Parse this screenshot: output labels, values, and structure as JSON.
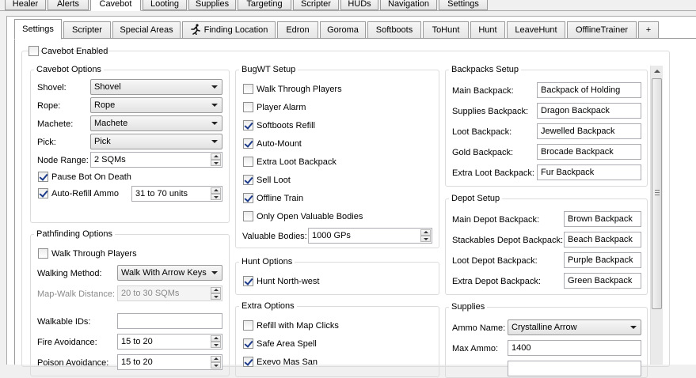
{
  "top_tabs": [
    "Healer",
    "Alerts",
    "Cavebot",
    "Looting",
    "Supplies",
    "Targeting",
    "Scripter",
    "HUDs",
    "Navigation",
    "Settings"
  ],
  "sub_tabs": [
    "Settings",
    "Scripter",
    "Special Areas",
    "Finding Location",
    "Edron",
    "Goroma",
    "Softboots",
    "ToHunt",
    "Hunt",
    "LeaveHunt",
    "OfflineTrainer",
    "+"
  ],
  "cavebot_enabled": {
    "label": "Cavebot Enabled",
    "checked": false
  },
  "cavebot_options": {
    "title": "Cavebot Options",
    "shovel_label": "Shovel:",
    "shovel_value": "Shovel",
    "rope_label": "Rope:",
    "rope_value": "Rope",
    "machete_label": "Machete:",
    "machete_value": "Machete",
    "pick_label": "Pick:",
    "pick_value": "Pick",
    "node_range_label": "Node Range:",
    "node_range_value": "2 SQMs",
    "pause_on_death": {
      "label": "Pause Bot On Death",
      "checked": true
    },
    "auto_refill_ammo": {
      "label": "Auto-Refill Ammo",
      "checked": true,
      "value": "31 to 70 units"
    }
  },
  "pathfinding_options": {
    "title": "Pathfinding Options",
    "walk_through_players": {
      "label": "Walk Through Players",
      "checked": false
    },
    "walking_method_label": "Walking Method:",
    "walking_method_value": "Walk With Arrow Keys",
    "map_walk_distance_label": "Map-Walk Distance:",
    "map_walk_distance_value": "20 to 30 SQMs",
    "walkable_ids_label": "Walkable IDs:",
    "walkable_ids_value": "",
    "fire_avoidance_label": "Fire Avoidance:",
    "fire_avoidance_value": "15 to 20",
    "poison_avoidance_label": "Poison Avoidance:",
    "poison_avoidance_value": "15 to 20"
  },
  "bugwt_setup": {
    "title": "BugWT Setup",
    "items": [
      {
        "label": "Walk Through Players",
        "checked": false
      },
      {
        "label": "Player Alarm",
        "checked": false
      },
      {
        "label": "Softboots Refill",
        "checked": true
      },
      {
        "label": "Auto-Mount",
        "checked": true
      },
      {
        "label": "Extra Loot Backpack",
        "checked": false
      },
      {
        "label": "Sell Loot",
        "checked": true
      },
      {
        "label": "Offline Train",
        "checked": true
      },
      {
        "label": "Only Open Valuable Bodies",
        "checked": false
      }
    ],
    "valuable_bodies_label": "Valuable Bodies:",
    "valuable_bodies_value": "1000 GPs"
  },
  "hunt_options": {
    "title": "Hunt Options",
    "hunt_north_west": {
      "label": "Hunt North-west",
      "checked": true
    }
  },
  "extra_options": {
    "title": "Extra Options",
    "items": [
      {
        "label": "Refill with Map Clicks",
        "checked": false
      },
      {
        "label": "Safe Area Spell",
        "checked": true
      },
      {
        "label": "Exevo Mas San",
        "checked": true
      }
    ]
  },
  "backpacks_setup": {
    "title": "Backpacks Setup",
    "rows": [
      {
        "label": "Main Backpack:",
        "value": "Backpack of Holding"
      },
      {
        "label": "Supplies Backpack:",
        "value": "Dragon Backpack"
      },
      {
        "label": "Loot Backpack:",
        "value": "Jewelled Backpack"
      },
      {
        "label": "Gold Backpack:",
        "value": "Brocade Backpack"
      },
      {
        "label": "Extra Loot Backpack:",
        "value": "Fur Backpack"
      }
    ]
  },
  "depot_setup": {
    "title": "Depot Setup",
    "rows": [
      {
        "label": "Main Depot Backpack:",
        "value": "Brown Backpack"
      },
      {
        "label": "Stackables Depot Backpack:",
        "value": "Beach Backpack"
      },
      {
        "label": "Loot Depot Backpack:",
        "value": "Purple Backpack"
      },
      {
        "label": "Extra Depot Backpack:",
        "value": "Green Backpack"
      }
    ]
  },
  "supplies": {
    "title": "Supplies",
    "ammo_name_label": "Ammo Name:",
    "ammo_name_value": "Crystalline Arrow",
    "max_ammo_label": "Max Ammo:",
    "max_ammo_value": "1400"
  },
  "colors": {
    "panel": "#ffffff",
    "window": "#f0f0f0",
    "check": "#1b3a8a"
  }
}
